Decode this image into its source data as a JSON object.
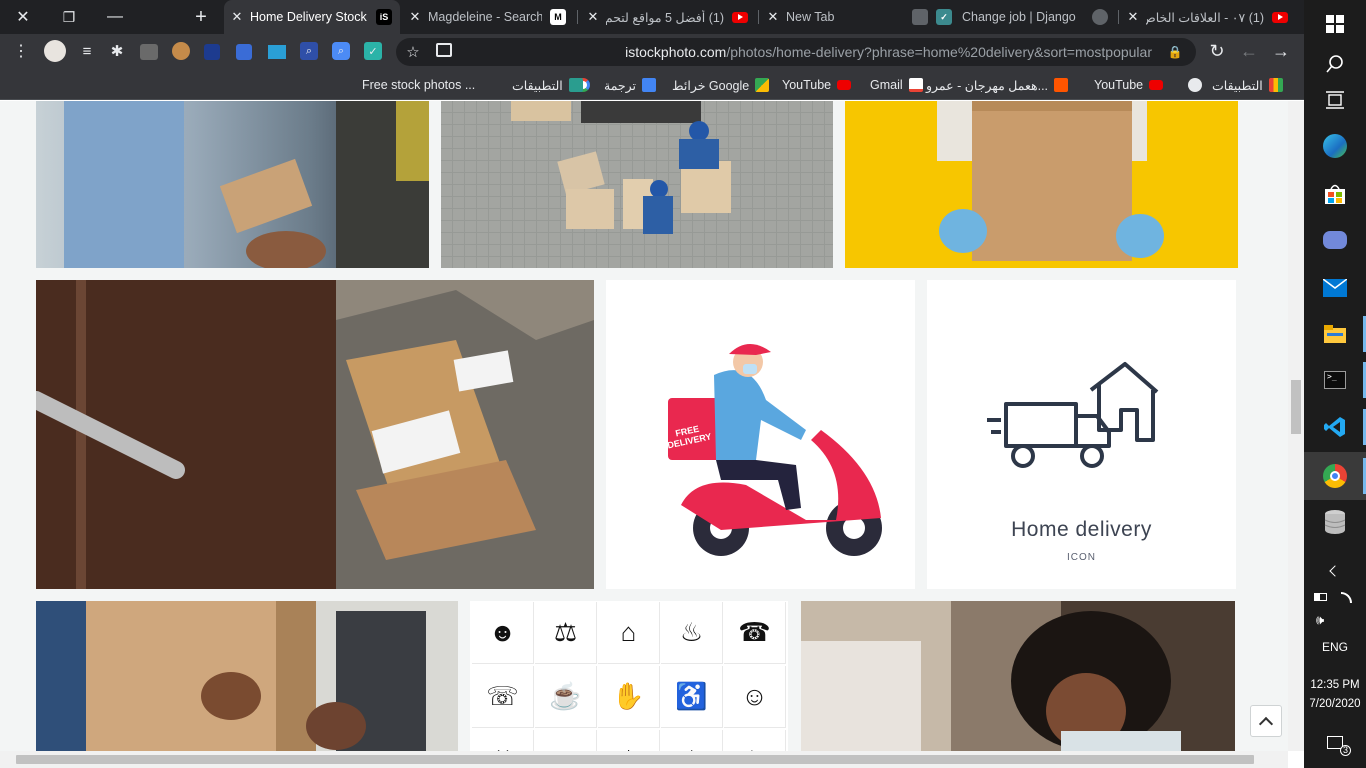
{
  "browser": {
    "tabs": [
      {
        "title": "Home Delivery Stock",
        "favicon": "istock-favicon",
        "active": true
      },
      {
        "title": "Magdeleine - Search",
        "favicon": "magdeleine-favicon"
      },
      {
        "title": "(1) أفضل 5 مواقع لتحم",
        "favicon": "youtube-favicon"
      },
      {
        "title": "New Tab",
        "favicon": ""
      },
      {
        "title": "Change job | Django",
        "favicon": "django-favicon"
      },
      {
        "title": "(1) ٠٧ - العلاقات الخاص",
        "favicon": "youtube-favicon"
      }
    ],
    "new_tab_symbol": "+",
    "close_window_symbol": "✕",
    "restore_symbol": "❐",
    "minimize_symbol": "—",
    "url_host": "istockphoto.com",
    "url_path": "/photos/home-delivery?phrase=home%20delivery&sort=mostpopular",
    "bookmarks": [
      {
        "label": "التطبيقات",
        "icon": "apps-grid-icon"
      },
      {
        "label": "",
        "icon": "globe-icon"
      },
      {
        "label": "YouTube",
        "icon": "youtube-icon"
      },
      {
        "label": "هعمل مهرجان - عمرو...",
        "icon": "soundcloud-icon"
      },
      {
        "label": "Gmail",
        "icon": "gmail-icon"
      },
      {
        "label": "YouTube",
        "icon": "youtube-icon"
      },
      {
        "label": "خرائط Google",
        "icon": "maps-icon"
      },
      {
        "label": "ترجمة",
        "icon": "translate-icon"
      },
      {
        "label": "",
        "icon": "google-icon"
      },
      {
        "label": "التطبيقات",
        "icon": "apps-icon"
      },
      {
        "label": "Free stock photos ...",
        "icon": "pexels-icon"
      }
    ]
  },
  "content": {
    "icon_card": {
      "title": "Home delivery",
      "subtitle": "ICON"
    },
    "scooter_card": {
      "badge_line1": "FREE",
      "badge_line2": "DELIVERY"
    }
  },
  "taskbar": {
    "language": "ENG",
    "time": "12:35 PM",
    "date": "7/20/2020",
    "notification_count": "3",
    "items": [
      "windows-start-icon",
      "search-icon",
      "task-view-icon",
      "edge-icon",
      "store-icon",
      "discord-icon",
      "mail-icon",
      "file-explorer-icon",
      "terminal-icon",
      "vscode-icon",
      "chrome-icon",
      "database-icon"
    ]
  },
  "colors": {
    "chrome_dark": "#202124",
    "chrome_toolbar": "#35363a",
    "page_bg": "#f3f5f5",
    "scooter_red": "#e9284f",
    "icon_navy": "#2d3748"
  }
}
